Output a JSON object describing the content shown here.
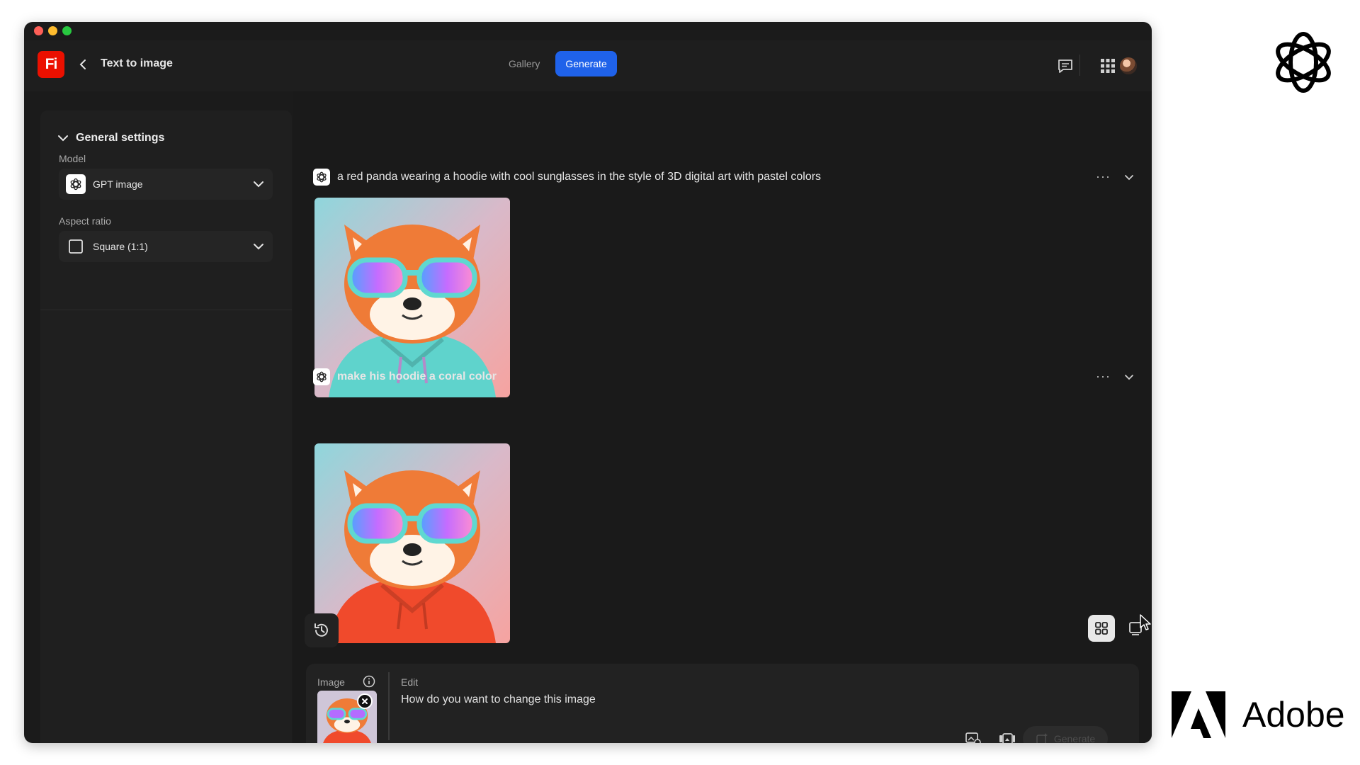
{
  "app": {
    "logo_text": "Fi",
    "title": "Text to image",
    "tabs": [
      {
        "label": "Gallery",
        "active": false
      },
      {
        "label": "Generate",
        "active": true
      }
    ]
  },
  "sidebar": {
    "section_title": "General settings",
    "model_label": "Model",
    "model_value": "GPT image",
    "aspect_label": "Aspect ratio",
    "aspect_value": "Square (1:1)"
  },
  "generations": [
    {
      "prompt": "a red panda wearing a hoodie with cool sunglasses in the style of 3D digital art with pastel colors",
      "hoodie_color": "#5fd3cc"
    },
    {
      "prompt": "make his hoodie a coral color",
      "hoodie_color": "#f04a2c"
    }
  ],
  "composer": {
    "image_label": "Image",
    "edit_label": "Edit",
    "placeholder": "How do you want to change this image",
    "generate_label": "Generate"
  },
  "branding": {
    "adobe": "Adobe"
  },
  "colors": {
    "accent": "#1f62ea",
    "firefly_red": "#eb1000"
  }
}
